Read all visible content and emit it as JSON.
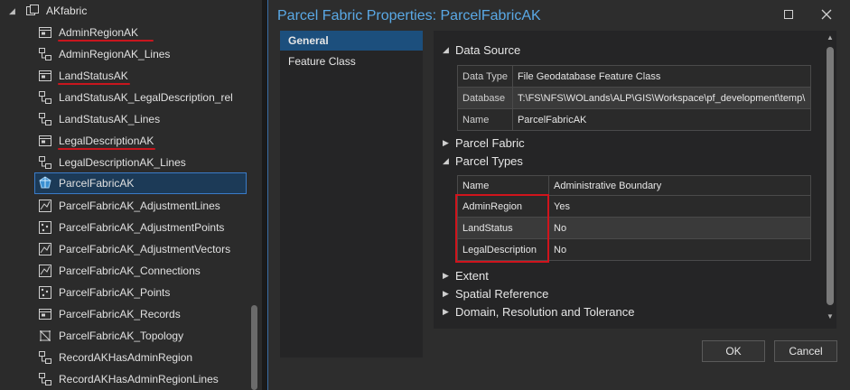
{
  "tree": {
    "root_label": "AKfabric",
    "items": [
      {
        "label": "AdminRegionAK",
        "icon": "table-icon"
      },
      {
        "label": "AdminRegionAK_Lines",
        "icon": "relationship-icon"
      },
      {
        "label": "LandStatusAK",
        "icon": "table-icon"
      },
      {
        "label": "LandStatusAK_LegalDescription_rel",
        "icon": "relationship-icon"
      },
      {
        "label": "LandStatusAK_Lines",
        "icon": "relationship-icon"
      },
      {
        "label": "LegalDescriptionAK",
        "icon": "table-icon"
      },
      {
        "label": "LegalDescriptionAK_Lines",
        "icon": "relationship-icon"
      },
      {
        "label": "ParcelFabricAK",
        "icon": "parcel-fabric-icon"
      },
      {
        "label": "ParcelFabricAK_AdjustmentLines",
        "icon": "line-feature-icon"
      },
      {
        "label": "ParcelFabricAK_AdjustmentPoints",
        "icon": "point-feature-icon"
      },
      {
        "label": "ParcelFabricAK_AdjustmentVectors",
        "icon": "line-feature-icon"
      },
      {
        "label": "ParcelFabricAK_Connections",
        "icon": "line-feature-icon"
      },
      {
        "label": "ParcelFabricAK_Points",
        "icon": "point-feature-icon"
      },
      {
        "label": "ParcelFabricAK_Records",
        "icon": "table-icon"
      },
      {
        "label": "ParcelFabricAK_Topology",
        "icon": "topology-icon"
      },
      {
        "label": "RecordAKHasAdminRegion",
        "icon": "relationship-icon"
      },
      {
        "label": "RecordAKHasAdminRegionLines",
        "icon": "relationship-icon"
      }
    ]
  },
  "dialog": {
    "title": "Parcel Fabric Properties: ParcelFabricAK",
    "nav": [
      "General",
      "Feature Class"
    ],
    "sections": {
      "data_source": "Data Source",
      "parcel_fabric": "Parcel Fabric",
      "parcel_types": "Parcel Types",
      "extent": "Extent",
      "spatial_reference": "Spatial Reference",
      "domain": "Domain, Resolution and Tolerance"
    },
    "data_source_rows": [
      {
        "key": "Data Type",
        "value": "File Geodatabase Feature Class"
      },
      {
        "key": "Database",
        "value": "T:\\FS\\NFS\\WOLands\\ALP\\GIS\\Workspace\\pf_development\\temp\\"
      },
      {
        "key": "Name",
        "value": "ParcelFabricAK"
      }
    ],
    "parcel_types_header": {
      "name": "Name",
      "admin": "Administrative Boundary"
    },
    "parcel_types_rows": [
      {
        "name": "AdminRegion",
        "admin": "Yes"
      },
      {
        "name": "LandStatus",
        "admin": "No"
      },
      {
        "name": "LegalDescription",
        "admin": "No"
      }
    ],
    "ok_label": "OK",
    "cancel_label": "Cancel"
  },
  "colors": {
    "accent": "#5aa9e6",
    "highlight_red": "#d0141c",
    "selection": "#1c4f7d"
  }
}
